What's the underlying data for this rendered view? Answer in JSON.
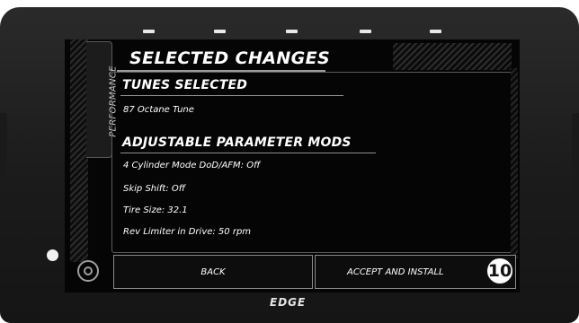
{
  "screen": {
    "performance_tab": "PERFORMANCE",
    "title": "SELECTED CHANGES",
    "sections": {
      "tunes_title": "TUNES SELECTED",
      "tunes_items": [
        "87 Octane Tune"
      ],
      "adjustable_title": "ADJUSTABLE PARAMETER MODS",
      "adjustable_items": [
        "4 Cylinder Mode DoD/AFM: Off",
        "Skip Shift: Off",
        "Tire Size: 32.1",
        "Rev Limiter in Drive: 50 rpm"
      ]
    },
    "buttons": {
      "back": "BACK",
      "accept": "ACCEPT AND INSTALL"
    }
  },
  "annotation": {
    "step_number": "10"
  },
  "device": {
    "logo": "EDGE"
  },
  "icons": [
    "home-icon"
  ]
}
